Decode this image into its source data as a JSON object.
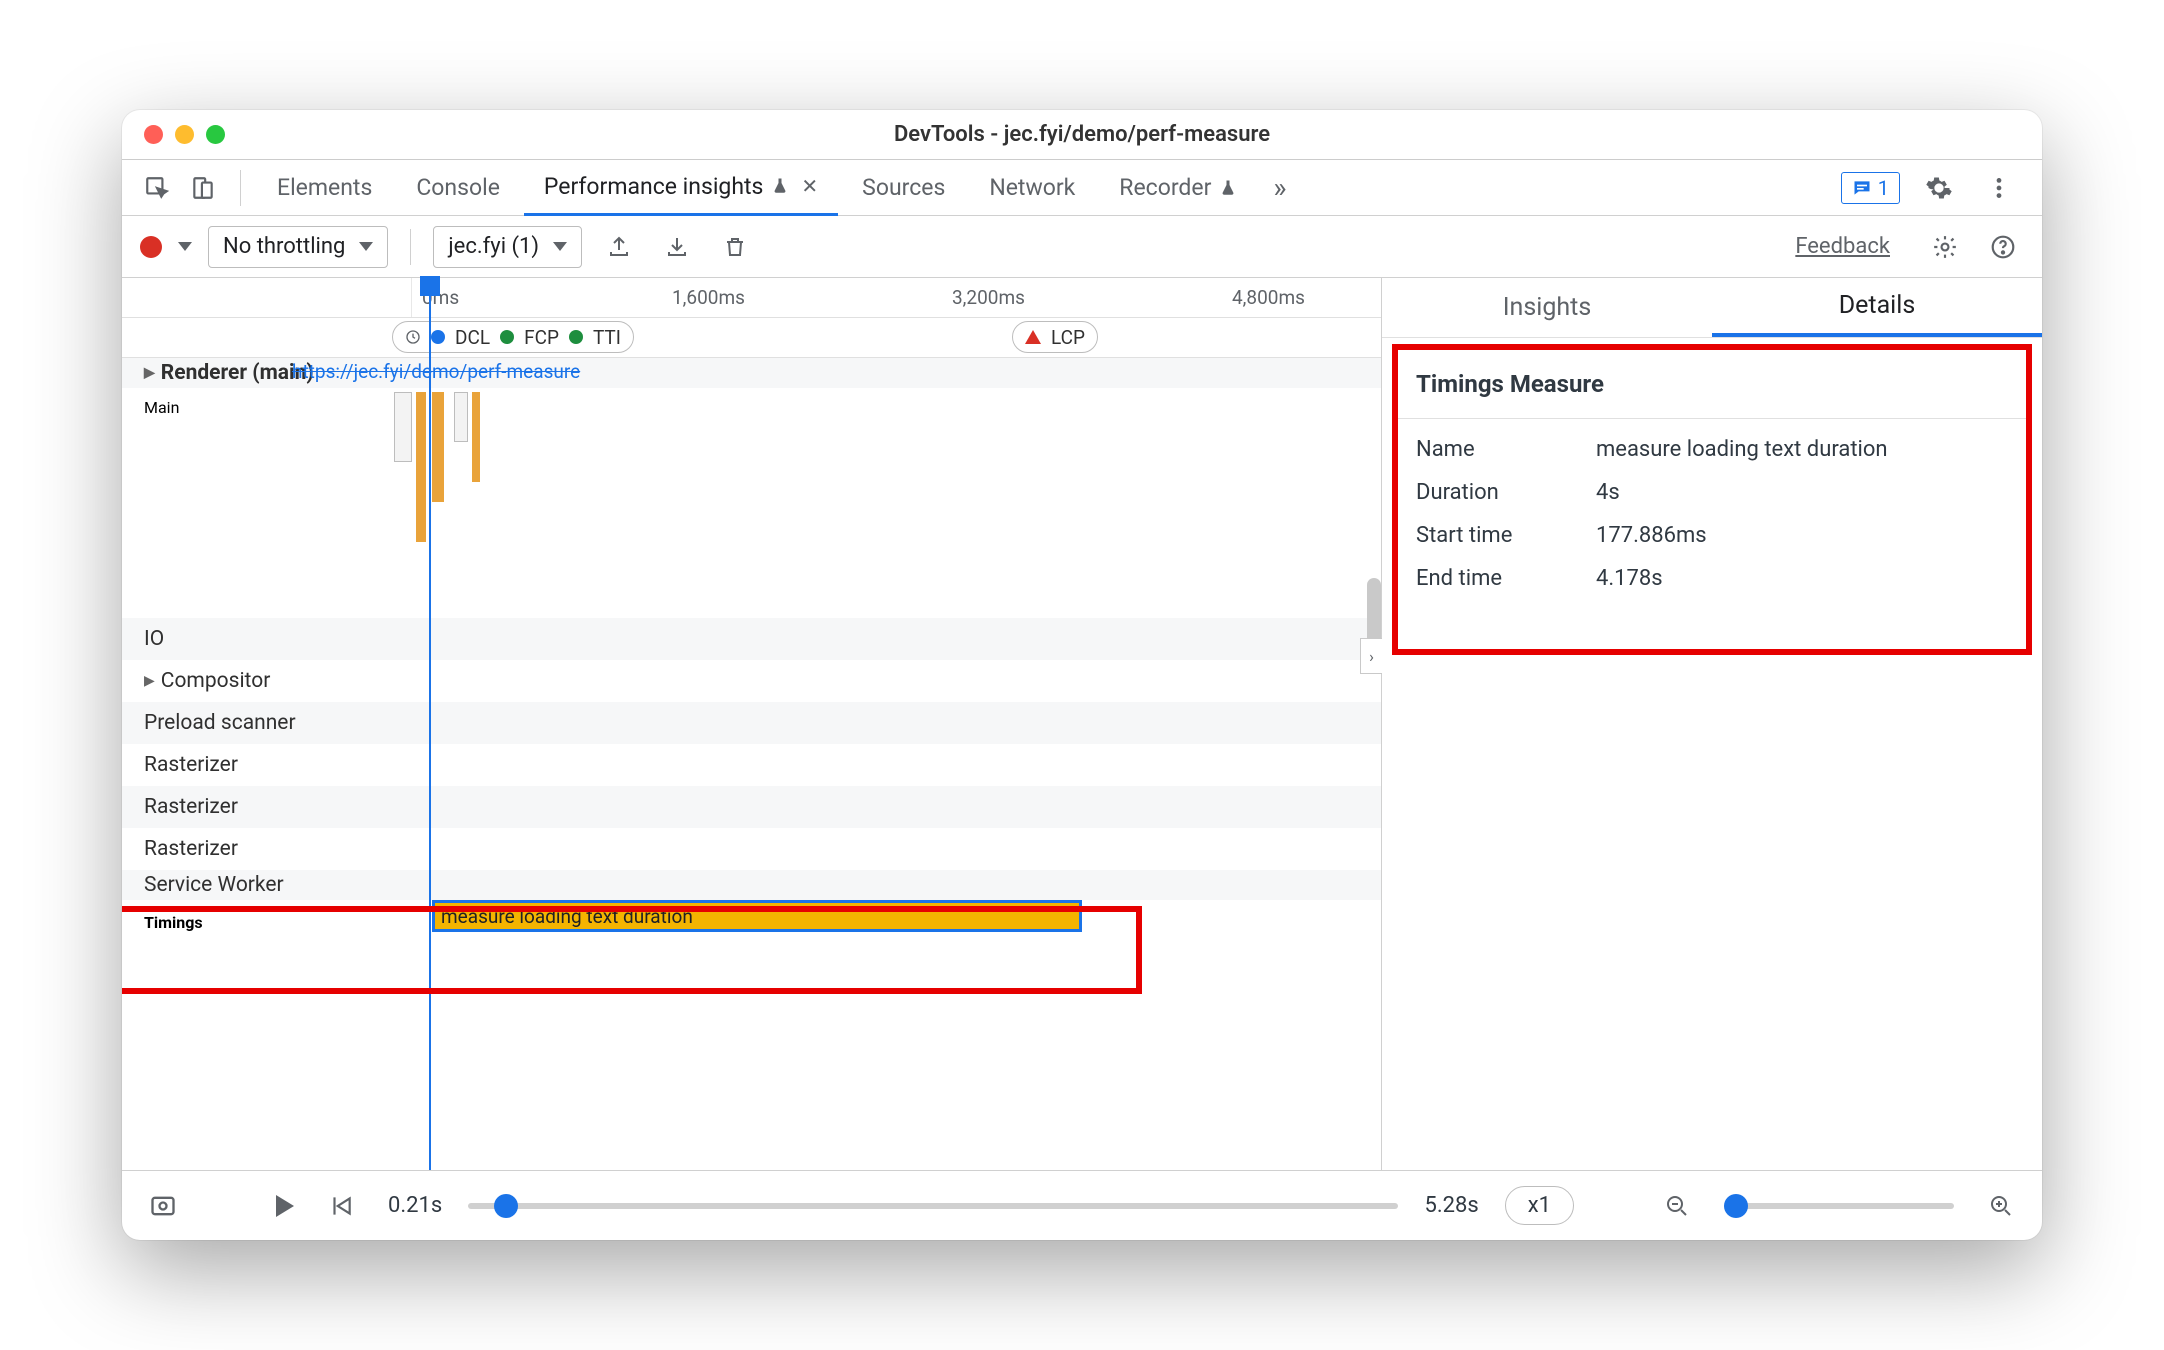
{
  "window": {
    "title": "DevTools - jec.fyi/demo/perf-measure"
  },
  "tabs": {
    "elements": "Elements",
    "console": "Console",
    "perf": "Performance insights",
    "sources": "Sources",
    "network": "Network",
    "recorder": "Recorder",
    "issues_count": "1"
  },
  "toolbar": {
    "throttle": "No throttling",
    "recording": "jec.fyi (1)",
    "feedback": "Feedback"
  },
  "ruler": {
    "t0": "0ms",
    "t1": "1,600ms",
    "t2": "3,200ms",
    "t3": "4,800ms"
  },
  "markers": {
    "dcl": "DCL",
    "fcp": "FCP",
    "tti": "TTI",
    "lcp": "LCP"
  },
  "tracks": {
    "renderer": "Renderer (main)",
    "renderer_url": "https://jec.fyi/demo/perf-measure",
    "main": "Main",
    "io": "IO",
    "compositor": "Compositor",
    "preload": "Preload scanner",
    "rasterizer": "Rasterizer",
    "service_worker": "Service Worker",
    "timings": "Timings"
  },
  "timings_bar": {
    "label": "measure loading text duration"
  },
  "right": {
    "insights_tab": "Insights",
    "details_tab": "Details",
    "heading": "Timings Measure",
    "name_k": "Name",
    "name_v": "measure loading text duration",
    "dur_k": "Duration",
    "dur_v": "4s",
    "start_k": "Start time",
    "start_v": "177.886ms",
    "end_k": "End time",
    "end_v": "4.178s"
  },
  "bottom": {
    "start": "0.21s",
    "end": "5.28s",
    "speed": "x1"
  }
}
